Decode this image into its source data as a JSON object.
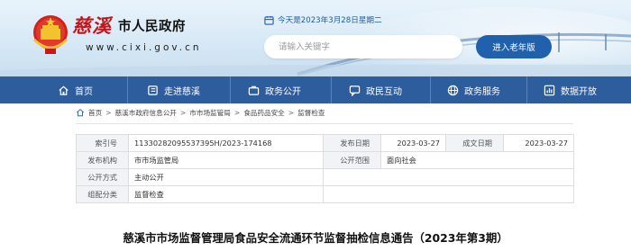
{
  "header": {
    "logo_brush": "慈溪",
    "logo_name": "市人民政府",
    "logo_url": "www.cixi.gov.cn",
    "date_text": "今天是2023年3月28日星期二",
    "search_placeholder": "请输入关键字",
    "elder_mode_label": "进入老年版"
  },
  "nav": {
    "items": [
      {
        "label": "首页",
        "icon": "home-icon"
      },
      {
        "label": "走进慈溪",
        "icon": "book-icon"
      },
      {
        "label": "政务公开",
        "icon": "briefcase-icon"
      },
      {
        "label": "政民互动",
        "icon": "chat-icon"
      },
      {
        "label": "政务服务",
        "icon": "globe-icon"
      },
      {
        "label": "数据开放",
        "icon": "chart-icon"
      }
    ]
  },
  "breadcrumb": [
    "首页",
    "慈溪市政府信息公开",
    "市市场监管局",
    "食品药品安全",
    "监督检查"
  ],
  "meta": {
    "index_label": "索引号",
    "index_value": "11330282095537395H/2023-174168",
    "publish_date_label": "发布日期",
    "publish_date_value": "2023-03-27",
    "created_date_label": "成文日期",
    "created_date_value": "2023-03-27",
    "org_label": "发布机构",
    "org_value": "市市场监管局",
    "scope_label": "公开范围",
    "scope_value": "面向社会",
    "method_label": "公开方式",
    "method_value": "主动公开",
    "category_label": "组配分类",
    "category_value": "监督检查"
  },
  "article": {
    "title": "慈溪市市场监督管理局食品安全流通环节监督抽检信息通告（2023年第3期）"
  },
  "colors": {
    "nav_bg": "#2e5d9e",
    "brand_red": "#c3171c",
    "accent_blue": "#2160ac"
  }
}
